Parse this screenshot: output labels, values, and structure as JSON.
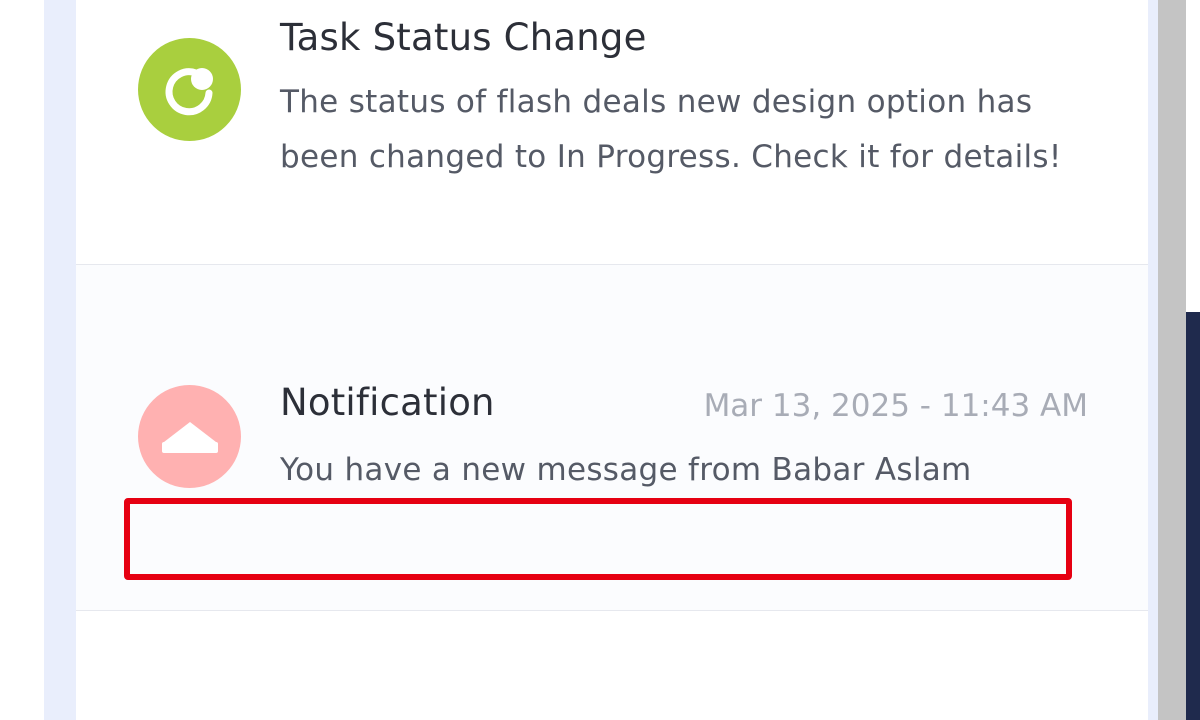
{
  "notifications": [
    {
      "icon": "status-change-icon",
      "avatar_color": "#a9cf3e",
      "title": "Task Status Change",
      "body": "The status of flash deals new design option has been changed to In Progress. Check it for details!",
      "timestamp": ""
    },
    {
      "icon": "inbox-icon",
      "avatar_color": "#ffb1b1",
      "title": "Notification",
      "body": "You have a new message from Babar Aslam",
      "timestamp": "Mar 13, 2025 - 11:43 AM"
    }
  ],
  "colors": {
    "highlight": "#e60012",
    "frame": "#e9eefc"
  }
}
